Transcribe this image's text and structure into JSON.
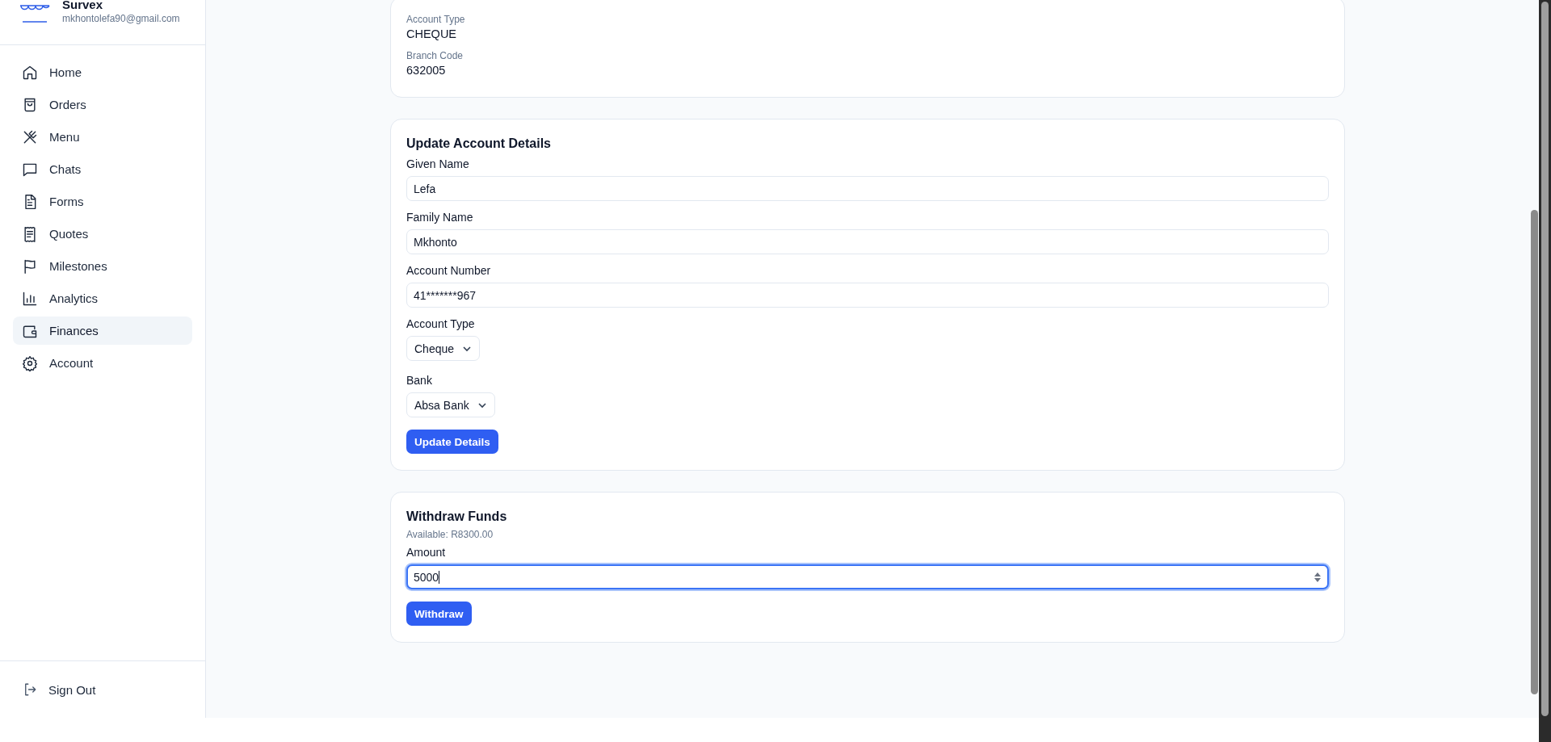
{
  "brand": {
    "name": "Survex",
    "email": "mkhontolefa90@gmail.com"
  },
  "nav": [
    {
      "label": "Home",
      "selected": false
    },
    {
      "label": "Orders",
      "selected": false
    },
    {
      "label": "Menu",
      "selected": false
    },
    {
      "label": "Chats",
      "selected": false
    },
    {
      "label": "Forms",
      "selected": false
    },
    {
      "label": "Quotes",
      "selected": false
    },
    {
      "label": "Milestones",
      "selected": false
    },
    {
      "label": "Analytics",
      "selected": false
    },
    {
      "label": "Finances",
      "selected": true
    },
    {
      "label": "Account",
      "selected": false
    }
  ],
  "sign_out": "Sign Out",
  "account_info": {
    "fields": [
      {
        "label": "Account Type",
        "value": "CHEQUE"
      },
      {
        "label": "Branch Code",
        "value": "632005"
      }
    ]
  },
  "update_form": {
    "title": "Update Account Details",
    "fields": [
      {
        "kind": "text",
        "label": "Given Name",
        "value": "Lefa"
      },
      {
        "kind": "text",
        "label": "Family Name",
        "value": "Mkhonto"
      },
      {
        "kind": "text",
        "label": "Account Number",
        "value": "41*******967"
      },
      {
        "kind": "select",
        "label": "Account Type",
        "value": "Cheque"
      },
      {
        "kind": "select",
        "label": "Bank",
        "value": "Absa Bank"
      }
    ],
    "button": "Update Details"
  },
  "withdraw": {
    "title": "Withdraw Funds",
    "available": "Available: R8300.00",
    "field": {
      "label": "Amount",
      "value": "5000",
      "focused": true
    },
    "button": "Withdraw"
  }
}
